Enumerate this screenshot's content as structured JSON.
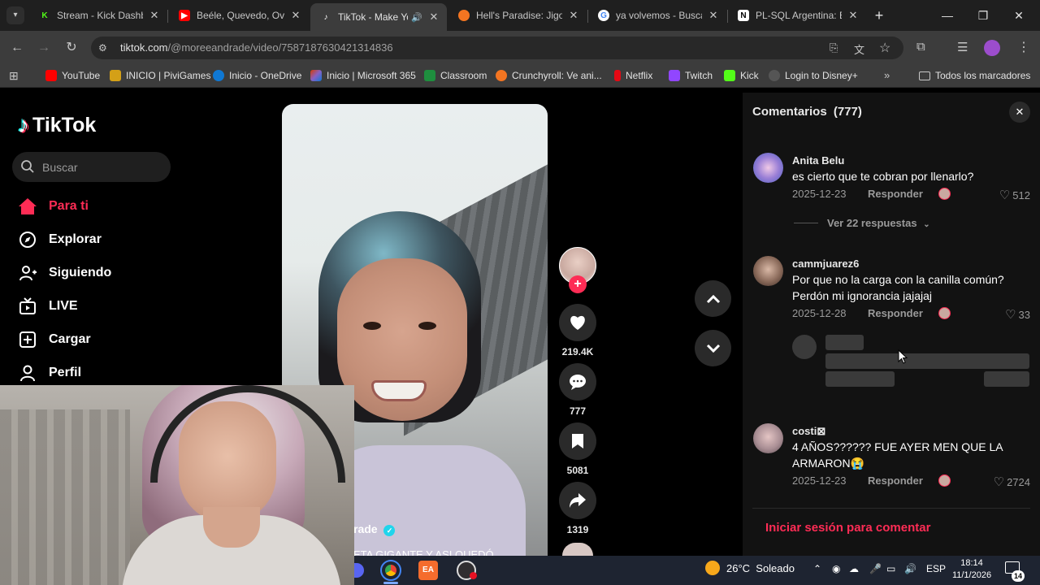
{
  "browser": {
    "tabs": [
      {
        "title": "Stream - Kick Dashbo",
        "favicon": "kick-icon",
        "color": "#53fc18",
        "active": false
      },
      {
        "title": "Beéle, Quevedo, Ovy",
        "favicon": "youtube-icon",
        "color": "#ff0000",
        "active": false
      },
      {
        "title": "TikTok - Make Yo",
        "favicon": "tiktok-icon",
        "color": "#ffffff",
        "active": true
      },
      {
        "title": "Hell's Paradise: Jigok",
        "favicon": "crunchyroll-icon",
        "color": "#f47521",
        "active": false
      },
      {
        "title": "ya volvemos - Buscar",
        "favicon": "google-icon",
        "color": "#4285f4",
        "active": false
      },
      {
        "title": "PL-SQL Argentina: En",
        "favicon": "notion-icon",
        "color": "#ffffff",
        "active": false
      }
    ],
    "url_host": "tiktok.com",
    "url_path": "/@moreeandrade/video/7587187630421314836",
    "bookmarks": [
      {
        "label": "YouTube",
        "color": "#ff0000"
      },
      {
        "label": "INICIO | PiviGames",
        "color": "#d4a017"
      },
      {
        "label": "Inicio - OneDrive",
        "color": "#0f78d4"
      },
      {
        "label": "Inicio | Microsoft 365",
        "color": "#d83b01"
      },
      {
        "label": "Classroom",
        "color": "#1e8e3e"
      },
      {
        "label": "Crunchyroll: Ve ani...",
        "color": "#f47521"
      },
      {
        "label": "Netflix",
        "color": "#e50914"
      },
      {
        "label": "Twitch",
        "color": "#9146ff"
      },
      {
        "label": "Kick",
        "color": "#53fc18"
      },
      {
        "label": "Login to Disney+",
        "color": "#113ccf"
      }
    ],
    "all_bookmarks": "Todos los marcadores"
  },
  "tiktok": {
    "logo": "TikTok",
    "search_placeholder": "Buscar",
    "nav": [
      {
        "label": "Para ti",
        "icon": "home-icon",
        "active": true
      },
      {
        "label": "Explorar",
        "icon": "compass-icon",
        "active": false
      },
      {
        "label": "Siguiendo",
        "icon": "user-plus-icon",
        "active": false
      },
      {
        "label": "LIVE",
        "icon": "live-icon",
        "active": false
      },
      {
        "label": "Cargar",
        "icon": "upload-icon",
        "active": false
      },
      {
        "label": "Perfil",
        "icon": "profile-icon",
        "active": false
      }
    ],
    "video": {
      "author_partial": "rade",
      "caption_partial": "ETA GIGANTE Y ASI QUEDÓ"
    },
    "actions": {
      "likes": "219.4K",
      "comments": "777",
      "saves": "5081",
      "shares": "1319"
    }
  },
  "comments_panel": {
    "title": "Comentarios",
    "count": "(777)",
    "view_replies": "Ver 22 respuestas",
    "reply_label": "Responder",
    "login_cta": "Iniciar sesión para comentar",
    "items": [
      {
        "user": "Anita Belu",
        "text": "es cierto que te cobran por llenarlo?",
        "date": "2025-12-23",
        "likes": "512"
      },
      {
        "user": "cammjuarez6",
        "text": "Por que no la carga con la canilla común? Perdón mi ignorancia jajajaj",
        "date": "2025-12-28",
        "likes": "33"
      },
      {
        "user": "costi⊠",
        "text": "4 AÑOS?????? FUE AYER MEN QUE LA ARMARON😭",
        "date": "2025-12-23",
        "likes": "2724"
      }
    ]
  },
  "taskbar": {
    "weather": "26°C  Soleado",
    "lang": "ESP",
    "time": "18:14",
    "date": "11/1/2026",
    "notifications": "14"
  }
}
